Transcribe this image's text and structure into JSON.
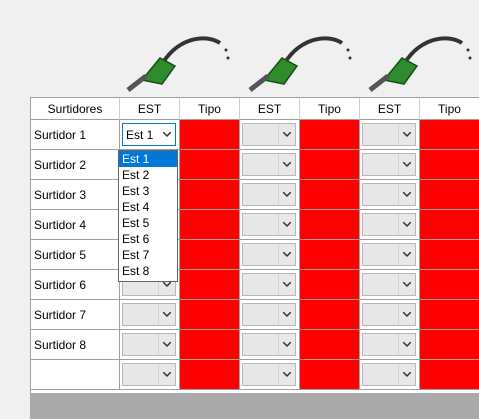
{
  "headers": [
    "Surtidores",
    "EST",
    "Tipo",
    "EST",
    "Tipo",
    "EST",
    "Tipo"
  ],
  "rows": [
    {
      "label": "Surtidor 1"
    },
    {
      "label": "Surtidor 2"
    },
    {
      "label": "Surtidor 3"
    },
    {
      "label": "Surtidor 4"
    },
    {
      "label": "Surtidor 5"
    },
    {
      "label": "Surtidor 6"
    },
    {
      "label": "Surtidor 7"
    },
    {
      "label": "Surtidor 8"
    },
    {
      "label": ""
    }
  ],
  "selected_est": "Est 1",
  "dropdown_options": [
    "Est 1",
    "Est 2",
    "Est 3",
    "Est 4",
    "Est 5",
    "Est 6",
    "Est 7",
    "Est 8"
  ],
  "colors": {
    "tipo_cell": "#ff0000",
    "selection": "#0078d7",
    "pump_green": "#2e8b2e"
  },
  "icons": {
    "pump": "fuel-nozzle-icon"
  }
}
